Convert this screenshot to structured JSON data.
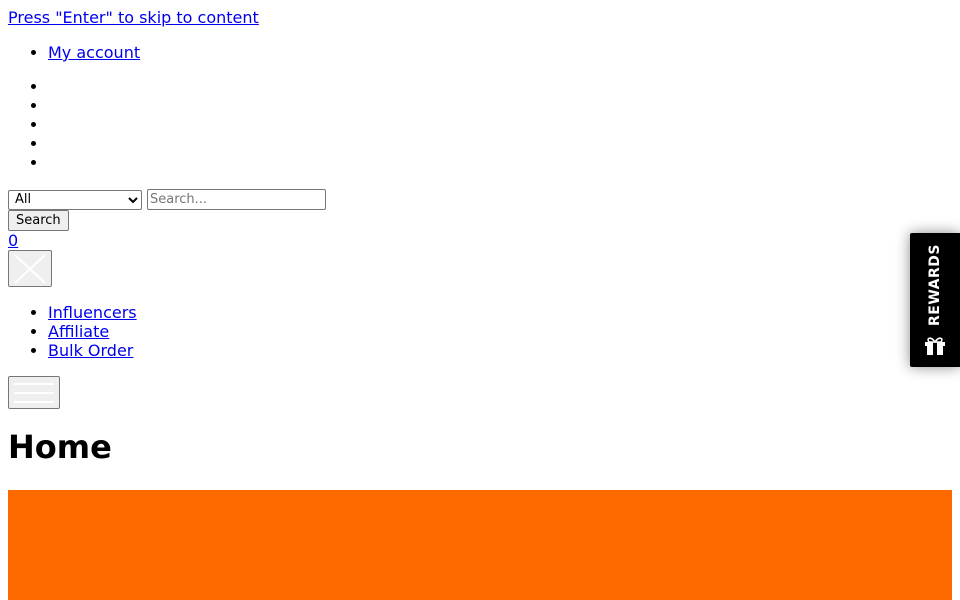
{
  "skip_link": "Press \"Enter\" to skip to content",
  "account": {
    "label": "My account"
  },
  "search": {
    "category_selected": "All",
    "placeholder": "Search...",
    "button_label": "Search"
  },
  "cart": {
    "count": "0"
  },
  "nav": {
    "items": [
      {
        "label": "Influencers"
      },
      {
        "label": "Affiliate"
      },
      {
        "label": "Bulk Order"
      }
    ]
  },
  "page_title": "Home",
  "rewards": {
    "label": "REWARDS"
  },
  "colors": {
    "banner": "#ff6a00",
    "rewards_bg": "#000000",
    "link": "#0000ee"
  },
  "icons": {
    "close": "close-icon",
    "menu": "hamburger-menu-icon",
    "gift": "gift-icon"
  }
}
